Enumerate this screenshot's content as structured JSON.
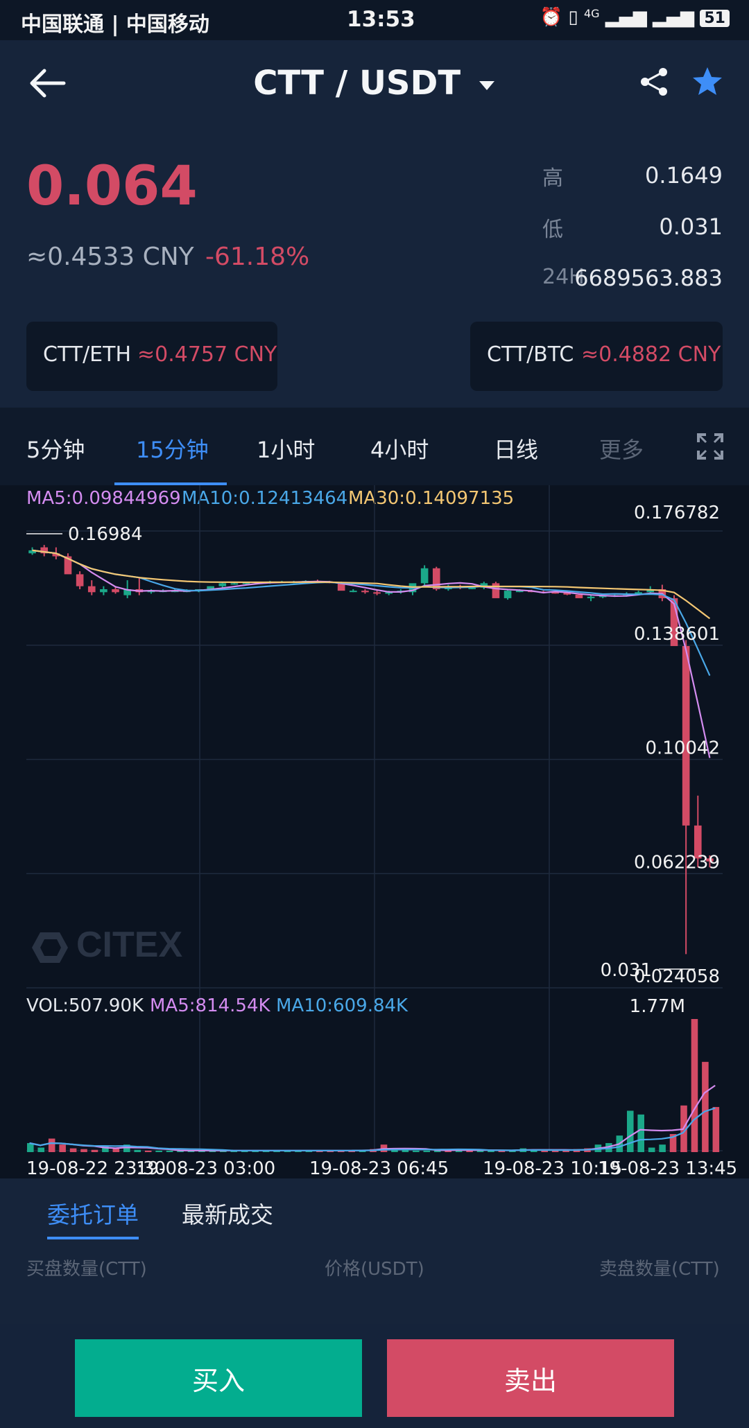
{
  "status_bar": {
    "carrier": "中国联通 | 中国移动",
    "time": "13:53",
    "network": "4G",
    "battery": "51"
  },
  "header": {
    "title": "CTT / USDT",
    "icons": [
      "back-arrow-icon",
      "dropdown-caret-icon",
      "share-icon",
      "star-icon"
    ],
    "star_color": "#3e8ef7"
  },
  "ticker": {
    "last_price": "0.064",
    "cny_price": "≈0.4533 CNY",
    "change": "-61.18%",
    "high_label": "高",
    "high_value": "0.1649",
    "low_label": "低",
    "low_value": "0.031",
    "vol_label": "24H",
    "vol_value": "6689563.883"
  },
  "pairs": [
    {
      "label": "CTT/ETH",
      "value": "≈0.4757 CNY"
    },
    {
      "label": "CTT/BTC",
      "value": "≈0.4882 CNY"
    }
  ],
  "intervals": {
    "items": [
      "5分钟",
      "15分钟",
      "1小时",
      "4小时",
      "日线",
      "更多"
    ],
    "active": "15分钟"
  },
  "chart_data": {
    "type": "candlestick",
    "ma_legend": [
      {
        "text": "MA5:0.09844969",
        "color": "#d48cf0"
      },
      {
        "text": "MA10:0.12413464",
        "color": "#4aa8e8"
      },
      {
        "text": "MA30:0.14097135",
        "color": "#f4c773"
      }
    ],
    "vol_legend": [
      {
        "text": "VOL:507.90K",
        "color": "#e6e9ee"
      },
      {
        "text": "MA5:814.54K",
        "color": "#d48cf0"
      },
      {
        "text": "MA10:609.84K",
        "color": "#4aa8e8"
      }
    ],
    "y_labels": [
      "0.176782",
      "0.138601",
      "0.10042",
      "0.062239",
      "0.024058"
    ],
    "y_range": [
      0.024058,
      0.176782
    ],
    "high_marker": "0.16984",
    "low_marker": "0.031",
    "vol_max_label": "1.77M",
    "x_labels": [
      "19-08-22 23:30",
      "19-08-23 03:00",
      "19-08-23 06:45",
      "19-08-23 10:15",
      "19-08-23 13:45"
    ],
    "watermark": "CITEX",
    "colors": {
      "up": "#1ba889",
      "down": "#d34b65"
    },
    "candles": [
      [
        0.167,
        0.169,
        0.1665,
        0.168
      ],
      [
        0.169,
        0.1698,
        0.166,
        0.167
      ],
      [
        0.167,
        0.169,
        0.165,
        0.166
      ],
      [
        0.166,
        0.167,
        0.162,
        0.16
      ],
      [
        0.16,
        0.161,
        0.155,
        0.156
      ],
      [
        0.156,
        0.158,
        0.153,
        0.154
      ],
      [
        0.154,
        0.156,
        0.153,
        0.155
      ],
      [
        0.155,
        0.156,
        0.1535,
        0.154
      ],
      [
        0.153,
        0.158,
        0.152,
        0.155
      ],
      [
        0.155,
        0.159,
        0.153,
        0.154
      ],
      [
        0.154,
        0.155,
        0.1535,
        0.1545
      ],
      [
        0.1545,
        0.155,
        0.154,
        0.1545
      ],
      [
        0.1545,
        0.155,
        0.154,
        0.1545
      ],
      [
        0.1545,
        0.155,
        0.154,
        0.1545
      ],
      [
        0.1545,
        0.155,
        0.154,
        0.155
      ],
      [
        0.155,
        0.156,
        0.1545,
        0.156
      ],
      [
        0.156,
        0.1575,
        0.1555,
        0.157
      ],
      [
        0.157,
        0.1575,
        0.1565,
        0.157
      ],
      [
        0.157,
        0.1575,
        0.1565,
        0.1572
      ],
      [
        0.1572,
        0.1575,
        0.1568,
        0.1572
      ],
      [
        0.1572,
        0.1578,
        0.1568,
        0.1575
      ],
      [
        0.1575,
        0.1578,
        0.157,
        0.1575
      ],
      [
        0.1575,
        0.1578,
        0.157,
        0.1575
      ],
      [
        0.1575,
        0.158,
        0.157,
        0.1578
      ],
      [
        0.1578,
        0.1582,
        0.157,
        0.1575
      ],
      [
        0.1575,
        0.1578,
        0.157,
        0.1572
      ],
      [
        0.1572,
        0.1575,
        0.156,
        0.1545
      ],
      [
        0.1545,
        0.155,
        0.154,
        0.1545
      ],
      [
        0.1545,
        0.155,
        0.1535,
        0.154
      ],
      [
        0.154,
        0.1545,
        0.153,
        0.1535
      ],
      [
        0.1535,
        0.1545,
        0.153,
        0.154
      ],
      [
        0.154,
        0.155,
        0.1535,
        0.1545
      ],
      [
        0.154,
        0.156,
        0.153,
        0.157
      ],
      [
        0.157,
        0.163,
        0.156,
        0.162
      ],
      [
        0.162,
        0.1625,
        0.1545,
        0.155
      ],
      [
        0.155,
        0.1565,
        0.1545,
        0.156
      ],
      [
        0.156,
        0.1565,
        0.155,
        0.1555
      ],
      [
        0.1555,
        0.156,
        0.155,
        0.1555
      ],
      [
        0.1555,
        0.1575,
        0.155,
        0.157
      ],
      [
        0.157,
        0.1575,
        0.153,
        0.152
      ],
      [
        0.152,
        0.155,
        0.1515,
        0.1545
      ],
      [
        0.1545,
        0.155,
        0.154,
        0.1545
      ],
      [
        0.1545,
        0.1548,
        0.154,
        0.1542
      ],
      [
        0.1542,
        0.1545,
        0.1538,
        0.154
      ],
      [
        0.154,
        0.1545,
        0.1535,
        0.1538
      ],
      [
        0.1538,
        0.1542,
        0.153,
        0.1532
      ],
      [
        0.1532,
        0.1535,
        0.1525,
        0.152
      ],
      [
        0.152,
        0.153,
        0.151,
        0.1525
      ],
      [
        0.1525,
        0.153,
        0.152,
        0.1528
      ],
      [
        0.1528,
        0.1532,
        0.1524,
        0.153
      ],
      [
        0.153,
        0.154,
        0.1525,
        0.1535
      ],
      [
        0.1535,
        0.1545,
        0.153,
        0.154
      ],
      [
        0.154,
        0.156,
        0.1535,
        0.155
      ],
      [
        0.155,
        0.1565,
        0.151,
        0.152
      ],
      [
        0.152,
        0.153,
        0.137,
        0.136
      ],
      [
        0.136,
        0.138,
        0.033,
        0.076
      ],
      [
        0.076,
        0.086,
        0.062,
        0.065
      ],
      [
        0.065,
        0.066,
        0.062,
        0.064
      ]
    ],
    "volume": [
      0.12,
      0.06,
      0.18,
      0.1,
      0.05,
      0.04,
      0.03,
      0.08,
      0.06,
      0.1,
      0.03,
      0.02,
      0.02,
      0.02,
      0.02,
      0.02,
      0.02,
      0.02,
      0.02,
      0.02,
      0.02,
      0.02,
      0.02,
      0.02,
      0.02,
      0.02,
      0.02,
      0.02,
      0.02,
      0.02,
      0.02,
      0.03,
      0.04,
      0.1,
      0.04,
      0.03,
      0.02,
      0.02,
      0.02,
      0.03,
      0.04,
      0.02,
      0.02,
      0.02,
      0.02,
      0.03,
      0.05,
      0.03,
      0.02,
      0.02,
      0.03,
      0.04,
      0.05,
      0.1,
      0.12,
      0.22,
      0.55,
      0.5,
      0.06,
      0.1,
      0.24,
      0.62,
      1.77,
      1.2,
      0.6
    ]
  },
  "orderbook": {
    "tabs": [
      "委托订单",
      "最新成交"
    ],
    "active": "委托订单",
    "headers": [
      "买盘数量(CTT)",
      "价格(USDT)",
      "卖盘数量(CTT)"
    ]
  },
  "actions": {
    "buy": "买入",
    "sell": "卖出",
    "buy_color": "#03ad8f",
    "sell_color": "#d34b65"
  }
}
